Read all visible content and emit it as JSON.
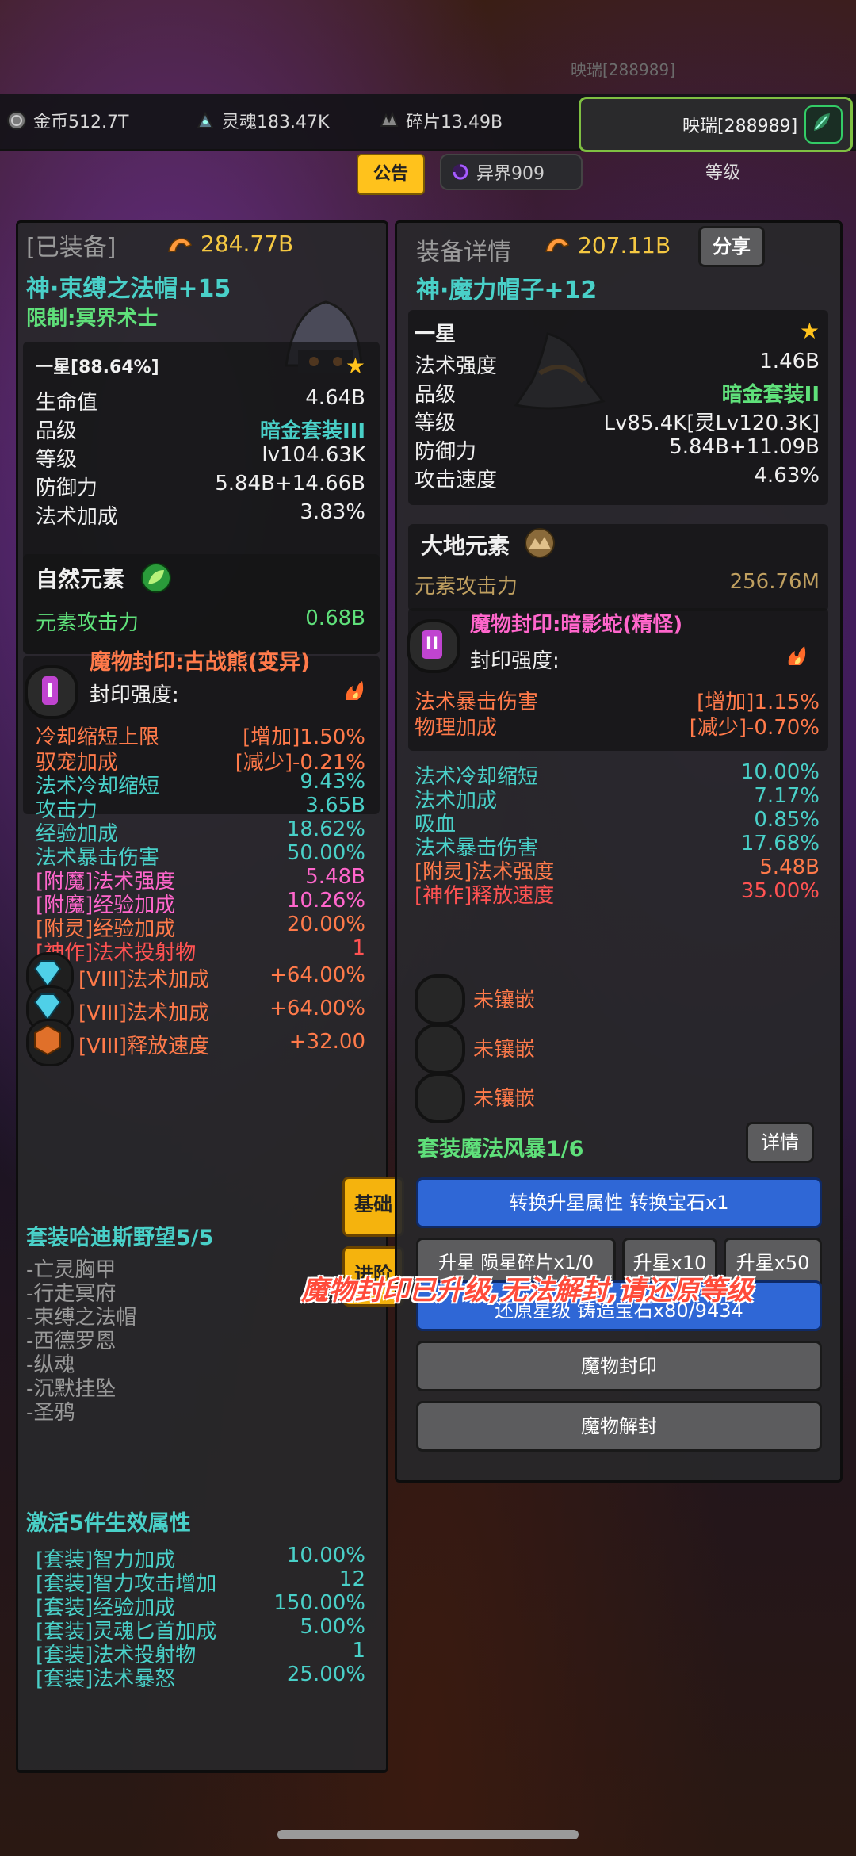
{
  "watermark": "映瑞[288989]",
  "currency": {
    "gold": "金币512.7T",
    "soul": "灵魂183.47K",
    "shard": "碎片13.49B"
  },
  "player": {
    "name": "映瑞[288989]",
    "level_label": "等级"
  },
  "notice_button": "公告",
  "realm": "异界909",
  "left": {
    "tag": "[已装备]",
    "power": "284.77B",
    "item_name": "神·束缚之法帽+15",
    "restriction": "限制:冥界术士",
    "star_label": "一星[88.64%]",
    "base_stats": [
      {
        "k": "生命值",
        "v": "4.64B"
      },
      {
        "k": "品级",
        "v": "暗金套装III"
      },
      {
        "k": "等级",
        "v": "lv104.63K"
      },
      {
        "k": "防御力",
        "v": "5.84B+14.66B"
      },
      {
        "k": "法术加成",
        "v": "3.83%"
      }
    ],
    "element_title": "自然元素",
    "element_stat": {
      "k": "元素攻击力",
      "v": "0.68B"
    },
    "seal_title": "魔物封印:古战熊(变异)",
    "seal_numeral": "I",
    "seal_strength": "封印强度:",
    "seal_stats": [
      {
        "k": "冷却缩短上限",
        "v": "[增加]1.50%"
      },
      {
        "k": "驭宠加成",
        "v": "[减少]-0.21%"
      }
    ],
    "stats": [
      {
        "k": "法术冷却缩短",
        "v": "9.43%"
      },
      {
        "k": "攻击力",
        "v": "3.65B"
      },
      {
        "k": "经验加成",
        "v": "18.62%"
      },
      {
        "k": "法术暴击伤害",
        "v": "50.00%"
      },
      {
        "k": "[附魔]法术强度",
        "v": "5.48B"
      },
      {
        "k": "[附魔]经验加成",
        "v": "10.26%"
      },
      {
        "k": "[附灵]经验加成",
        "v": "20.00%"
      },
      {
        "k": "[神作]法术投射物",
        "v": "1"
      }
    ],
    "gems": [
      {
        "k": "[VIII]法术加成",
        "v": "+64.00%"
      },
      {
        "k": "[VIII]法术加成",
        "v": "+64.00%"
      },
      {
        "k": "[VIII]释放速度",
        "v": "+32.00"
      }
    ],
    "set_title": "套装哈迪斯野望5/5",
    "set_pieces": [
      "-亡灵胸甲",
      "-行走冥府",
      "-束缚之法帽",
      "-西德罗恩",
      "-纵魂",
      "-沉默挂坠",
      "-圣鸦"
    ],
    "set_active_title": "激活5件生效属性",
    "set_stats": [
      {
        "k": "[套装]智力加成",
        "v": "10.00%"
      },
      {
        "k": "[套装]智力攻击增加",
        "v": "12"
      },
      {
        "k": "[套装]经验加成",
        "v": "150.00%"
      },
      {
        "k": "[套装]灵魂匕首加成",
        "v": "5.00%"
      },
      {
        "k": "[套装]法术投射物",
        "v": "1"
      },
      {
        "k": "[套装]法术暴怒",
        "v": "25.00%"
      }
    ]
  },
  "tabs": {
    "basic": "基础",
    "advanced": "进阶"
  },
  "right": {
    "tag": "装备详情",
    "power": "207.11B",
    "share": "分享",
    "item_name": "神·魔力帽子+12",
    "star_label": "一星",
    "base_stats": [
      {
        "k": "法术强度",
        "v": "1.46B"
      },
      {
        "k": "品级",
        "v": "暗金套装II"
      },
      {
        "k": "等级",
        "v": "Lv85.4K[灵Lv120.3K]"
      },
      {
        "k": "防御力",
        "v": "5.84B+11.09B"
      },
      {
        "k": "攻击速度",
        "v": "4.63%"
      }
    ],
    "element_title": "大地元素",
    "element_stat": {
      "k": "元素攻击力",
      "v": "256.76M"
    },
    "seal_title": "魔物封印:暗影蛇(精怪)",
    "seal_numeral": "II",
    "seal_strength": "封印强度:",
    "seal_stats": [
      {
        "k": "法术暴击伤害",
        "v": "[增加]1.15%"
      },
      {
        "k": "物理加成",
        "v": "[减少]-0.70%"
      }
    ],
    "stats": [
      {
        "k": "法术冷却缩短",
        "v": "10.00%"
      },
      {
        "k": "法术加成",
        "v": "7.17%"
      },
      {
        "k": "吸血",
        "v": "0.85%"
      },
      {
        "k": "法术暴击伤害",
        "v": "17.68%"
      },
      {
        "k": "[附灵]法术强度",
        "v": "5.48B"
      },
      {
        "k": "[神作]释放速度",
        "v": "35.00%"
      }
    ],
    "sockets": [
      "未镶嵌",
      "未镶嵌",
      "未镶嵌"
    ],
    "set_title": "套装魔法风暴1/6",
    "details": "详情",
    "convert_button": "转换升星属性 转换宝石x1",
    "upgrade_button": "升星 陨星碎片x1/0",
    "upgrade10": "升星x10",
    "upgrade50": "升星x50",
    "restore_button": "还原星级 铸造宝石x80/9434",
    "seal_button": "魔物封印",
    "unseal_button": "魔物解封"
  },
  "toast": "魔物封印已升级,无法解封,请还原等级"
}
